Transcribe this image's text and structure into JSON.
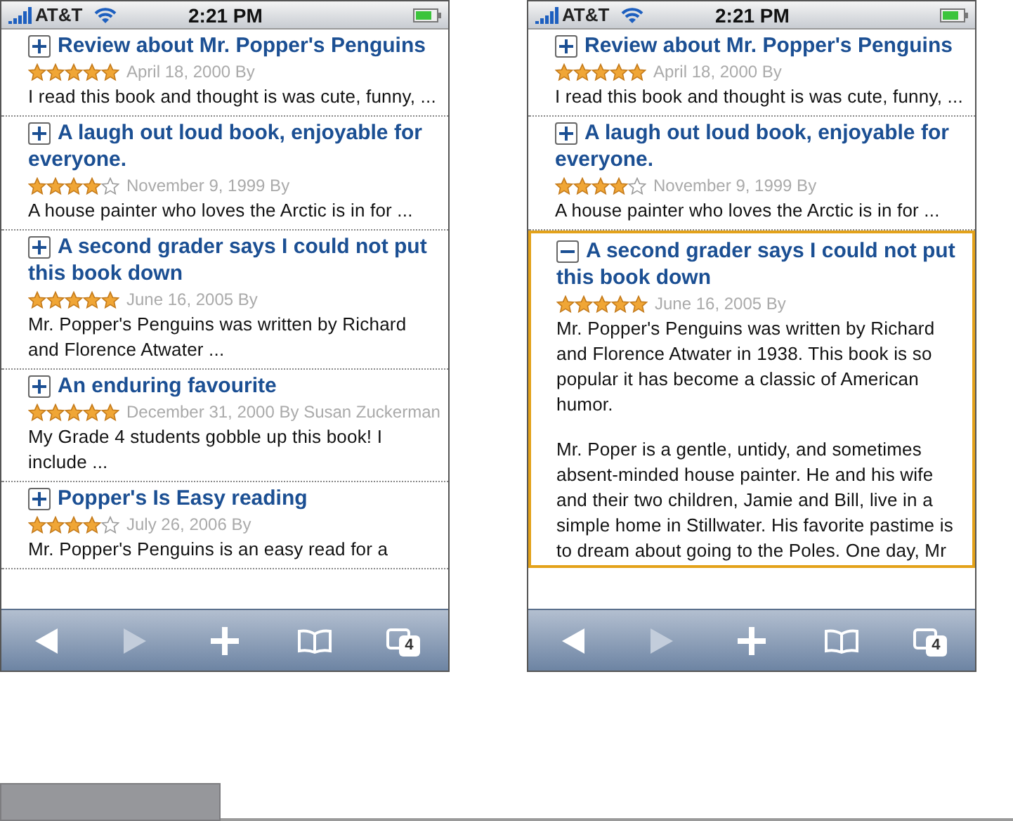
{
  "screens": [
    {
      "status_bar": {
        "carrier": "AT&T",
        "time": "2:21 PM"
      },
      "reviews": [
        {
          "title": "Review about Mr. Popper's Penguins",
          "expanded": false,
          "stars": 5,
          "meta": "April 18, 2000 By",
          "body": [
            "I read this book and thought is was cute, funny, ..."
          ]
        },
        {
          "title": "A laugh out loud book, enjoyable for everyone.",
          "expanded": false,
          "stars": 4,
          "meta": "November 9, 1999 By",
          "body": [
            "A house painter who loves the Arctic is in for ..."
          ]
        },
        {
          "title": "A second grader says I could not put this book down",
          "expanded": false,
          "stars": 5,
          "meta": "June 16, 2005 By",
          "body": [
            "Mr. Popper's Penguins was written by Richard and Florence Atwater ..."
          ]
        },
        {
          "title": "An enduring favourite",
          "expanded": false,
          "stars": 5,
          "meta": "December 31, 2000 By Susan Zuckerman",
          "body": [
            "My Grade 4 students gobble up this book! I include ..."
          ]
        },
        {
          "title": "Popper's Is Easy reading",
          "expanded": false,
          "stars": 4,
          "meta": "July 26, 2006 By",
          "body": [
            "Mr. Popper's Penguins is an easy read for a"
          ]
        }
      ],
      "toolbar": {
        "forward_disabled": true,
        "tab_count": "4"
      }
    },
    {
      "status_bar": {
        "carrier": "AT&T",
        "time": "2:21 PM"
      },
      "reviews": [
        {
          "title": "Review about Mr. Popper's Penguins",
          "expanded": false,
          "stars": 5,
          "meta": "April 18, 2000 By",
          "body": [
            "I read this book and thought is was cute, funny, ..."
          ]
        },
        {
          "title": "A laugh out loud book, enjoyable for everyone.",
          "expanded": false,
          "stars": 4,
          "meta": "November 9, 1999 By",
          "body": [
            "A house painter who loves the Arctic is in for ..."
          ]
        },
        {
          "title": "A second grader says I could not put this book down",
          "expanded": true,
          "stars": 5,
          "meta": "June 16, 2005 By",
          "body": [
            "Mr. Popper's Penguins was written by Richard and Florence Atwater in 1938. This book is so popular it has become a classic of American humor.",
            "Mr. Poper is a gentle, untidy, and sometimes absent-minded house painter. He and his wife and their two children, Jamie and Bill, live in a simple home in Stillwater. His favorite pastime is to dream about going to the Poles. One day, Mr"
          ]
        }
      ],
      "toolbar": {
        "forward_disabled": true,
        "tab_count": "4"
      }
    }
  ]
}
